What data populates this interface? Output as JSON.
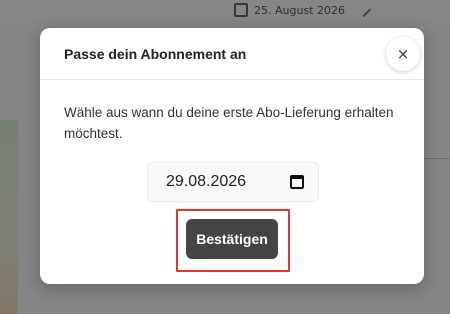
{
  "background": {
    "date_label": "25. August 2026"
  },
  "modal": {
    "title": "Passe dein Abonnement an",
    "close_symbol": "×",
    "description": "Wähle aus wann du deine erste Abo-Lieferung erhalten möchtest.",
    "date_value": "29.08.2026",
    "confirm_label": "Bestätigen"
  },
  "icons": {
    "close": "close-icon",
    "calendar": "calendar-icon"
  },
  "colors": {
    "confirm_button": "#454545",
    "highlight_border": "#e3342f"
  }
}
